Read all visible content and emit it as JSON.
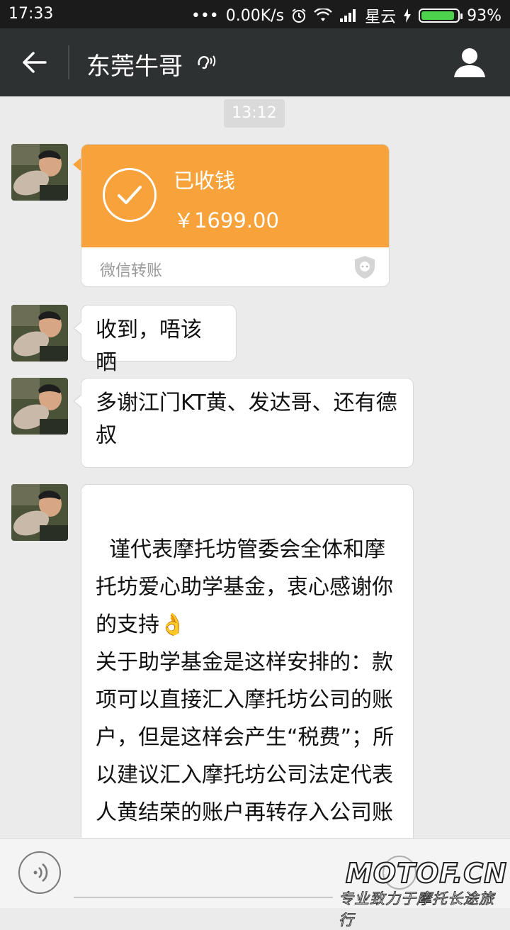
{
  "statusbar": {
    "time": "17:33",
    "dots": "•••",
    "speed": "0.00K/s",
    "carrier": "星云",
    "battery_pct": "93%",
    "battery_level": 0.93
  },
  "header": {
    "title": "东莞牛哥"
  },
  "chat": {
    "timestamp": "13:12",
    "transfer": {
      "status": "已收钱",
      "amount": "￥1699.00",
      "source": "微信转账",
      "accent": "#f7a23a"
    },
    "messages": [
      {
        "text": "收到，唔该晒"
      },
      {
        "text": "多谢江门KT黄、发达哥、还有德叔"
      },
      {
        "text": "谨代表摩托坊管委会全体和摩托坊爱心助学基金，衷心感谢你的支持👌\n关于助学基金是这样安排的：款项可以直接汇入摩托坊公司的账户，但是这样会产生“税费”；所以建议汇入摩托坊公司法定代表人黄结荣的账户再转存入公司账户，这样就能够节省税费。"
      }
    ]
  },
  "watermark": {
    "logo": "MOTOF.CN",
    "slogan": "专业致力于摩托长途旅行"
  },
  "colors": {
    "header_bg": "#2e3132",
    "chat_bg": "#ebebeb",
    "statusbar_bg": "#1b1b1b"
  }
}
